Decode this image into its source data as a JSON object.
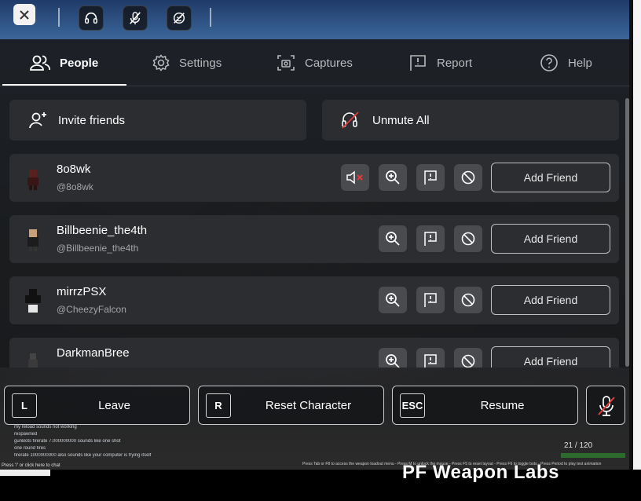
{
  "top_strip": {
    "icons": [
      "headset-icon",
      "mic-muted-icon",
      "self-view-off-icon"
    ]
  },
  "tabs": [
    {
      "label": "People",
      "icon": "people-icon"
    },
    {
      "label": "Settings",
      "icon": "gear-icon"
    },
    {
      "label": "Captures",
      "icon": "camera-icon"
    },
    {
      "label": "Report",
      "icon": "flag-icon"
    },
    {
      "label": "Help",
      "icon": "help-icon"
    }
  ],
  "actions": {
    "invite_label": "Invite friends",
    "unmute_label": "Unmute All"
  },
  "players": [
    {
      "name": "8o8wk",
      "username": "@8o8wk",
      "muted": true,
      "add_label": "Add Friend"
    },
    {
      "name": "Billbeenie_the4th",
      "username": "@Billbeenie_the4th",
      "muted": false,
      "add_label": "Add Friend"
    },
    {
      "name": "mirrzPSX",
      "username": "@CheezyFalcon",
      "muted": false,
      "add_label": "Add Friend"
    },
    {
      "name": "DarkmanBree",
      "username": "",
      "muted": false,
      "add_label": "Add Friend"
    }
  ],
  "bottom": {
    "leave": {
      "key": "L",
      "label": "Leave"
    },
    "reset": {
      "key": "R",
      "label": "Reset Character"
    },
    "resume": {
      "key": "ESC",
      "label": "Resume"
    }
  },
  "chat": {
    "lines": [
      "my reload sounds not working",
      "respawned",
      "gunBots firerate 7.000000000 sounds like one shot",
      "one round fires",
      "firerate 1000000000 also sounds like your computer is frying itself"
    ],
    "hint": "Press '/' or click here to chat"
  },
  "hud": {
    "help_text": "Press Tab or F8 to access the weapon loadout menu - Press M to unlock the mouse - Press F5 to reset layout - Press F6 to toggle bots - Press Period to play test animation",
    "counter": "21 / 120",
    "weapon_title": "PF Weapon Labs"
  },
  "colors": {
    "panel_bg": "#1a1b1d",
    "row_bg": "#2c2d30",
    "icon_btn_bg": "#4a4b4e",
    "mute_red": "#e03b3b"
  }
}
